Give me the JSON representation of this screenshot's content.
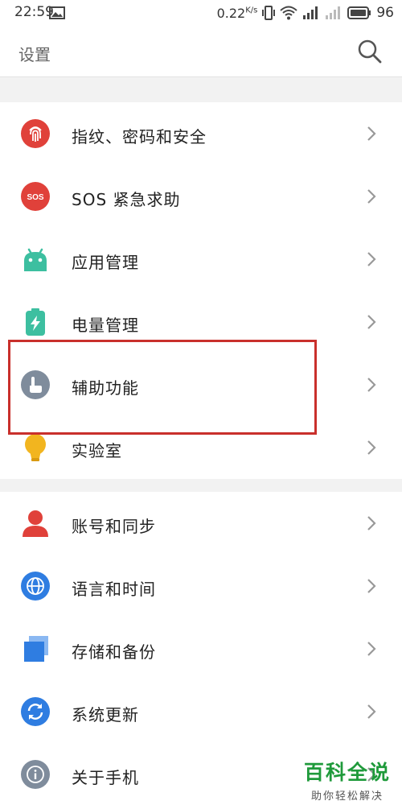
{
  "status_bar": {
    "time": "22:59",
    "net_speed": "0.22",
    "net_speed_unit": "K/s",
    "battery": "96"
  },
  "header": {
    "title": "设置",
    "search_icon": "search-icon"
  },
  "groups": [
    {
      "items": [
        {
          "label": "指纹、密码和安全",
          "icon": "fingerprint-icon",
          "color": "#e0413a"
        },
        {
          "label": "SOS 紧急求助",
          "icon": "sos-icon",
          "color": "#e0413a"
        },
        {
          "label": "应用管理",
          "icon": "android-icon",
          "color": "#3dbfa0"
        },
        {
          "label": "电量管理",
          "icon": "battery-icon",
          "color": "#3dbfa0"
        },
        {
          "label": "辅助功能",
          "icon": "hand-pointer-icon",
          "color": "#7f8c9c"
        },
        {
          "label": "实验室",
          "icon": "bulb-icon",
          "color": "#f2b51f"
        }
      ]
    },
    {
      "items": [
        {
          "label": "账号和同步",
          "icon": "user-icon",
          "color": "#e0413a"
        },
        {
          "label": "语言和时间",
          "icon": "globe-icon",
          "color": "#2f7de1"
        },
        {
          "label": "存储和备份",
          "icon": "storage-icon",
          "color": "#2f7de1"
        },
        {
          "label": "系统更新",
          "icon": "refresh-icon",
          "color": "#2f7de1"
        },
        {
          "label": "关于手机",
          "icon": "info-icon",
          "color": "#7f8c9c"
        }
      ]
    }
  ],
  "watermark": {
    "brand": "百科全说",
    "tagline": "助你轻松解决"
  }
}
